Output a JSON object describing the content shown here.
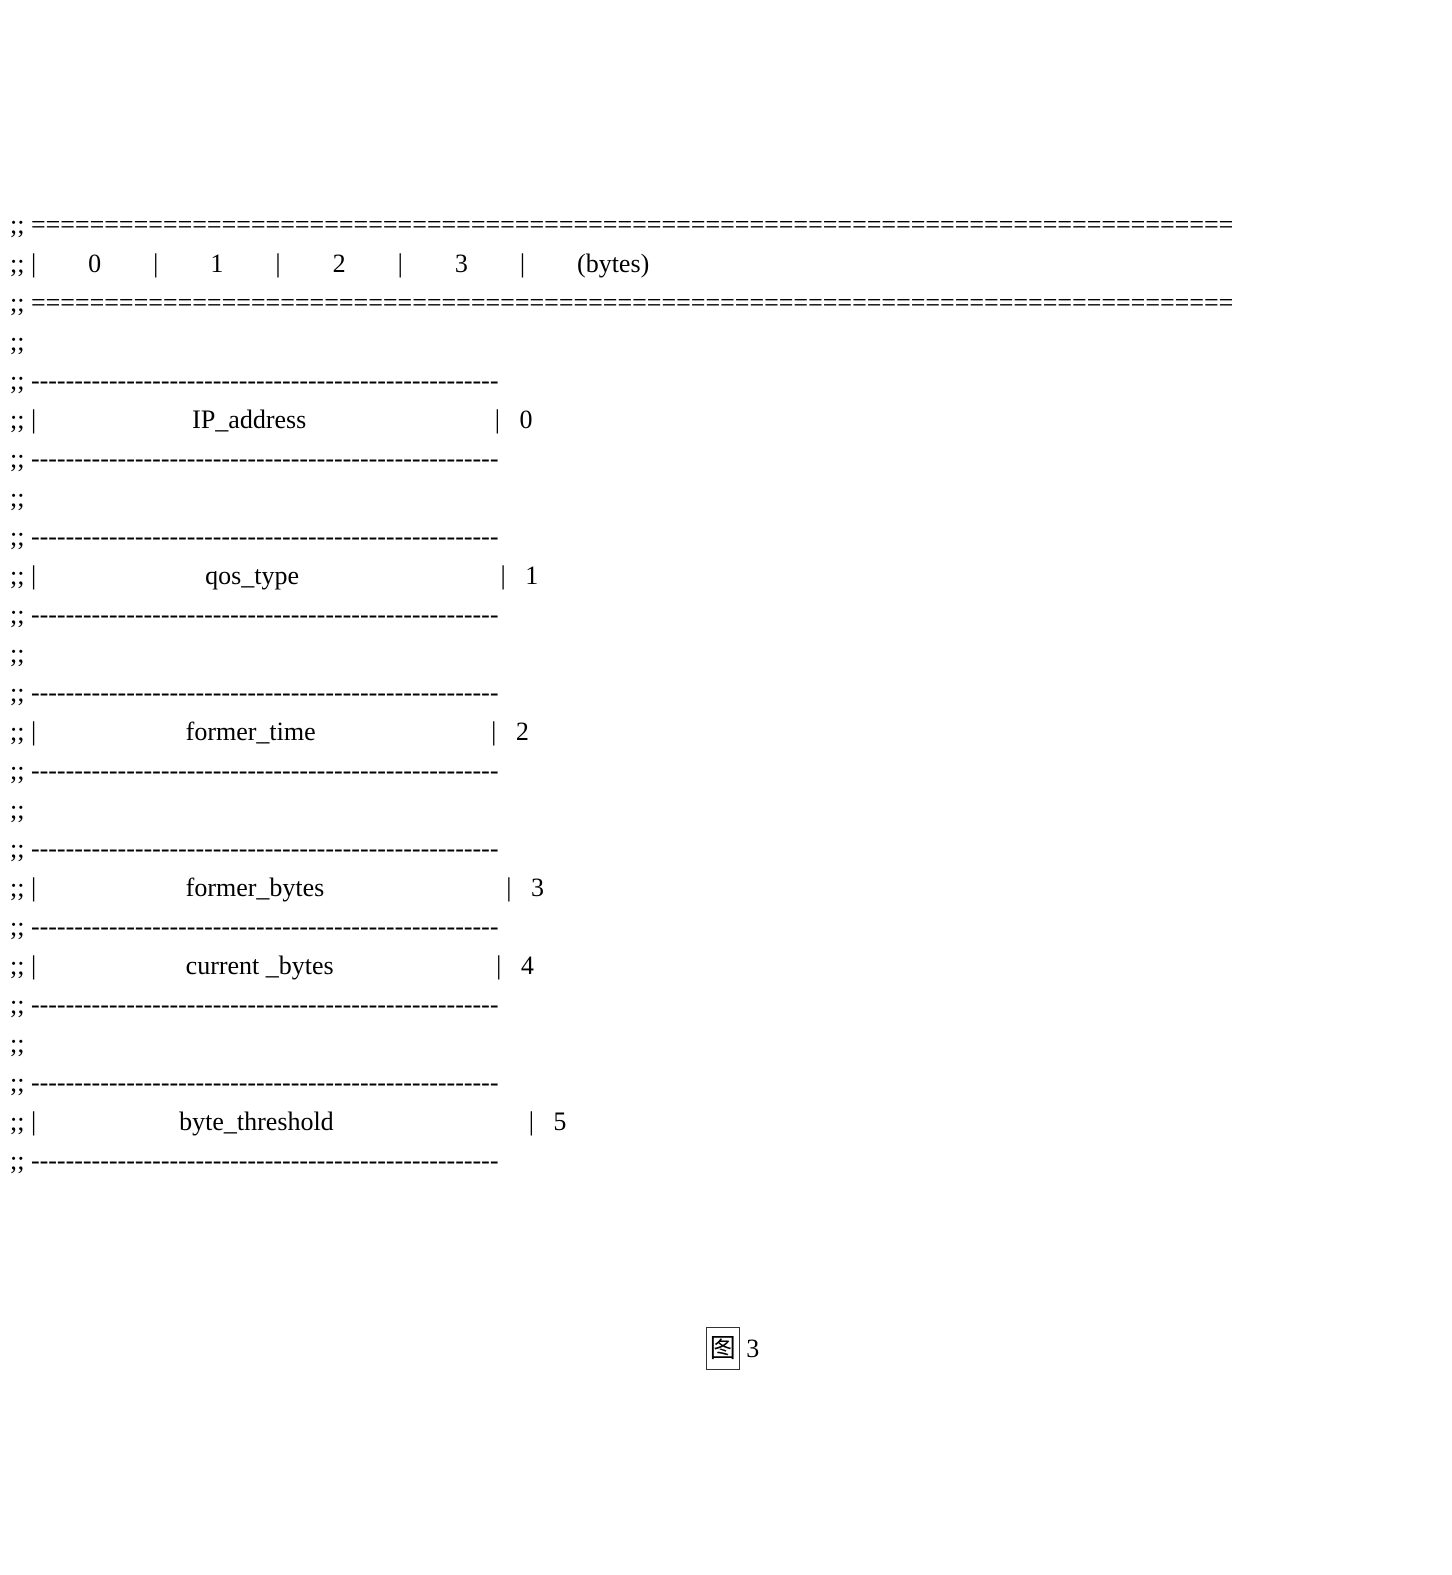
{
  "header": {
    "col0": "0",
    "col1": "1",
    "col2": "2",
    "col3": "3",
    "bytes_label": "(bytes)"
  },
  "fields": {
    "f0": {
      "name": "IP_address",
      "offset": "0"
    },
    "f1": {
      "name": "qos_type",
      "offset": "1"
    },
    "f2": {
      "name": "former_time",
      "offset": "2"
    },
    "f3": {
      "name": "former_bytes",
      "offset": "3"
    },
    "f4": {
      "name": "current _bytes",
      "offset": "4"
    },
    "f5": {
      "name": "byte_threshold",
      "offset": "5"
    }
  },
  "caption": {
    "label": "图",
    "number": "3"
  }
}
